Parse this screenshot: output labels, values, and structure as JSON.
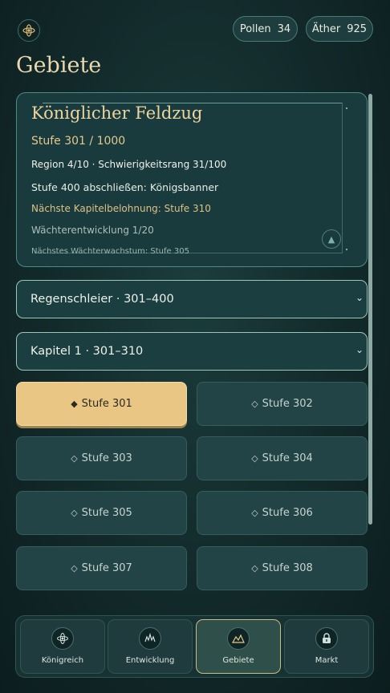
{
  "header": {
    "pollen_label": "Pollen",
    "pollen_value": "34",
    "aether_label": "Äther",
    "aether_value": "925"
  },
  "page_title": "Gebiete",
  "campaign": {
    "title": "Königlicher Feldzug",
    "stage_progress": "Stufe 301 / 1000",
    "region_rank": "Region 4/10 · Schwierigkeitsrang 31/100",
    "goal": "Stufe 400 abschließen: Königsbanner",
    "next_reward": "Nächste Kapitelbelohnung: Stufe 310",
    "guardian": "Wächterentwicklung 1/20",
    "guardian_next": "Nächstes Wächterwachstum: Stufe 305"
  },
  "region_select": {
    "value": "Regenschleier · 301–400"
  },
  "chapter_select": {
    "value": "Kapitel 1 · 301–310"
  },
  "stages": [
    {
      "label": "Stufe 301",
      "mark": "◆",
      "active": true
    },
    {
      "label": "Stufe 302",
      "mark": "◇",
      "active": false
    },
    {
      "label": "Stufe 303",
      "mark": "◇",
      "active": false
    },
    {
      "label": "Stufe 304",
      "mark": "◇",
      "active": false
    },
    {
      "label": "Stufe 305",
      "mark": "◇",
      "active": false
    },
    {
      "label": "Stufe 306",
      "mark": "◇",
      "active": false
    },
    {
      "label": "Stufe 307",
      "mark": "◇",
      "active": false
    },
    {
      "label": "Stufe 308",
      "mark": "◇",
      "active": false
    }
  ],
  "nav": [
    {
      "label": "Königreich",
      "icon": "kingdom-icon",
      "active": false
    },
    {
      "label": "Entwicklung",
      "icon": "development-icon",
      "active": false
    },
    {
      "label": "Gebiete",
      "icon": "regions-icon",
      "active": true
    },
    {
      "label": "Markt",
      "icon": "market-icon",
      "active": false
    }
  ],
  "colors": {
    "accent": "#e9c684",
    "panel": "#1a3b3d",
    "border": "#4f8a86"
  }
}
